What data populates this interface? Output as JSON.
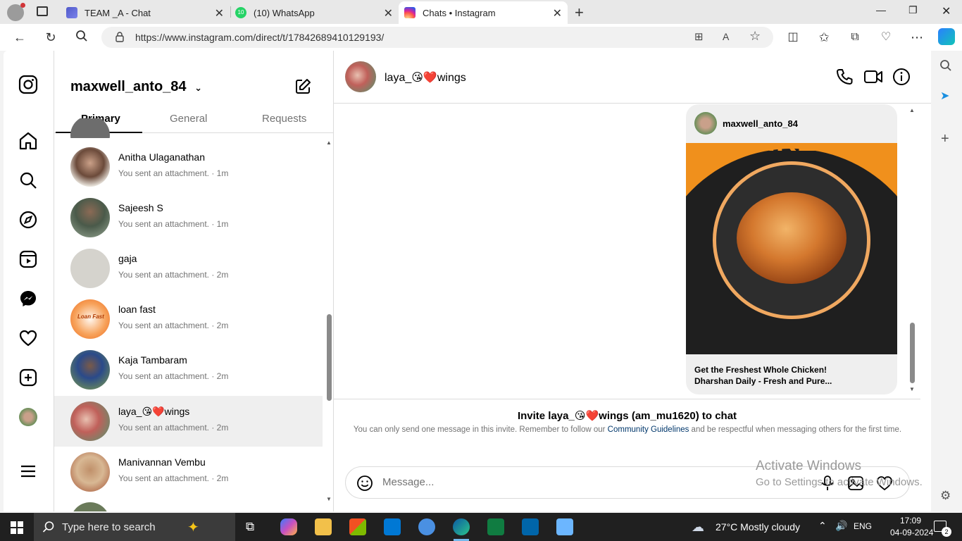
{
  "browser": {
    "tabs": [
      {
        "title": "TEAM _A - Chat",
        "icon": "teams-chat-icon"
      },
      {
        "title": "(10) WhatsApp",
        "icon": "whatsapp-icon"
      },
      {
        "title": "Chats • Instagram",
        "icon": "instagram-icon"
      }
    ],
    "url": "https://www.instagram.com/direct/t/17842689410129193/",
    "whatsapp_badge": "10"
  },
  "inbox": {
    "account": "maxwell_anto_84",
    "tabs": [
      "Primary",
      "General",
      "Requests"
    ],
    "selected_tab": "Primary",
    "conversations": [
      {
        "name": "Anitha Ulaganathan",
        "preview": "You sent an attachment. · 1m"
      },
      {
        "name": "Sajeesh S",
        "preview": "You sent an attachment. · 1m"
      },
      {
        "name": "gaja",
        "preview": "You sent an attachment. · 2m"
      },
      {
        "name": "loan fast",
        "preview": "You sent an attachment. · 2m"
      },
      {
        "name": "Kaja Tambaram",
        "preview": "You sent an attachment. · 2m"
      },
      {
        "name": "laya_😘❤️wings",
        "preview": "You sent an attachment. · 2m",
        "selected": true
      },
      {
        "name": "Manivannan Vembu",
        "preview": "You sent an attachment. · 2m"
      }
    ],
    "loan_logo_text": "Loan Fast"
  },
  "chat": {
    "name": "laya_😘❤️wings",
    "shared_post": {
      "user": "maxwell_anto_84",
      "image_text": "CHIKEN",
      "caption_line1": "Get the Freshest Whole Chicken!",
      "caption_line2": "Dharshan Daily - Fresh and Pure..."
    },
    "invite_title": "Invite laya_😘❤️wings (am_mu1620) to chat",
    "invite_text_before": "You can only send one message in this invite. Remember to follow our ",
    "invite_link": "Community Guidelines",
    "invite_text_after": " and be respectful when messaging others for the first time.",
    "message_placeholder": "Message..."
  },
  "watermark": {
    "line1": "Activate Windows",
    "line2": "Go to Settings to activate Windows."
  },
  "taskbar": {
    "search_placeholder": "Type here to search",
    "weather": "27°C  Mostly cloudy",
    "language": "ENG",
    "time": "17:09",
    "date": "04-09-2024",
    "notification_count": "2"
  },
  "colors": {
    "instagram_blue_link": "#00376b",
    "selected_row": "#efefef",
    "card_orange": "#f0901c"
  }
}
